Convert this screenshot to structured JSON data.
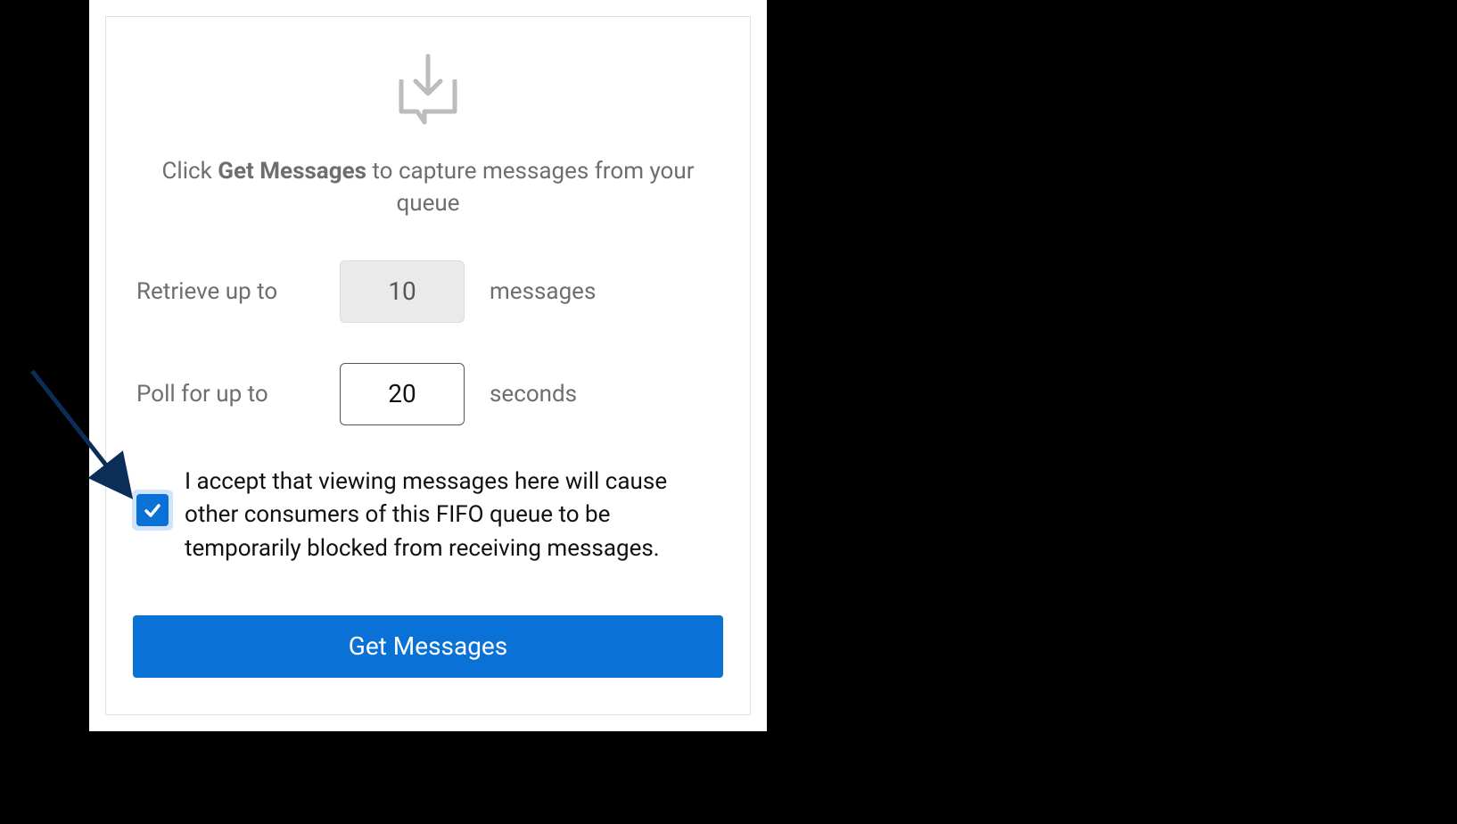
{
  "instruction": {
    "prefix": "Click ",
    "bold": "Get Messages",
    "suffix": " to capture messages from your queue"
  },
  "retrieve": {
    "label": "Retrieve up to",
    "value": "10",
    "suffix": "messages"
  },
  "poll": {
    "label": "Poll for up to",
    "value": "20",
    "suffix": "seconds"
  },
  "consent": {
    "checked": true,
    "text": "I accept that viewing messages here will cause other consumers of this FIFO queue to be temporarily blocked from receiving messages."
  },
  "button": {
    "label": "Get Messages"
  }
}
